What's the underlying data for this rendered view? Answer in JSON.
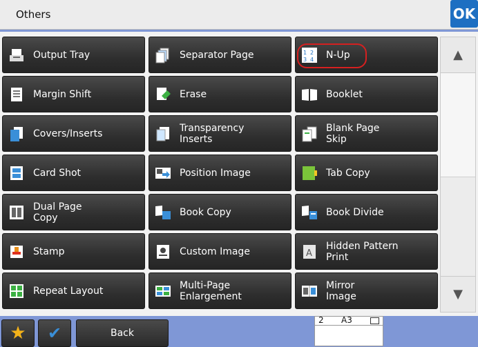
{
  "header": {
    "title": "Others",
    "ok_label": "OK"
  },
  "grid": {
    "items": [
      {
        "label": "Output Tray",
        "icon": "output-tray-icon"
      },
      {
        "label": "Separator Page",
        "icon": "separator-page-icon"
      },
      {
        "label": "N-Up",
        "icon": "n-up-icon"
      },
      {
        "label": "Margin Shift",
        "icon": "margin-shift-icon"
      },
      {
        "label": "Erase",
        "icon": "erase-icon"
      },
      {
        "label": "Booklet",
        "icon": "booklet-icon"
      },
      {
        "label": "Covers/Inserts",
        "icon": "covers-inserts-icon"
      },
      {
        "label": "Transparency\nInserts",
        "icon": "transparency-inserts-icon"
      },
      {
        "label": "Blank Page\nSkip",
        "icon": "blank-page-skip-icon"
      },
      {
        "label": "Card Shot",
        "icon": "card-shot-icon"
      },
      {
        "label": "Position Image",
        "icon": "position-image-icon"
      },
      {
        "label": "Tab Copy",
        "icon": "tab-copy-icon"
      },
      {
        "label": "Dual Page\nCopy",
        "icon": "dual-page-copy-icon"
      },
      {
        "label": "Book Copy",
        "icon": "book-copy-icon"
      },
      {
        "label": "Book Divide",
        "icon": "book-divide-icon"
      },
      {
        "label": "Stamp",
        "icon": "stamp-icon"
      },
      {
        "label": "Custom Image",
        "icon": "custom-image-icon"
      },
      {
        "label": "Hidden Pattern\nPrint",
        "icon": "hidden-pattern-print-icon"
      },
      {
        "label": "Repeat Layout",
        "icon": "repeat-layout-icon"
      },
      {
        "label": "Multi-Page\nEnlargement",
        "icon": "multi-page-enlargement-icon"
      },
      {
        "label": "Mirror\nImage",
        "icon": "mirror-image-icon"
      }
    ]
  },
  "footer": {
    "back_label": "Back"
  },
  "paper_preview": {
    "count": "2",
    "size": "A3"
  }
}
